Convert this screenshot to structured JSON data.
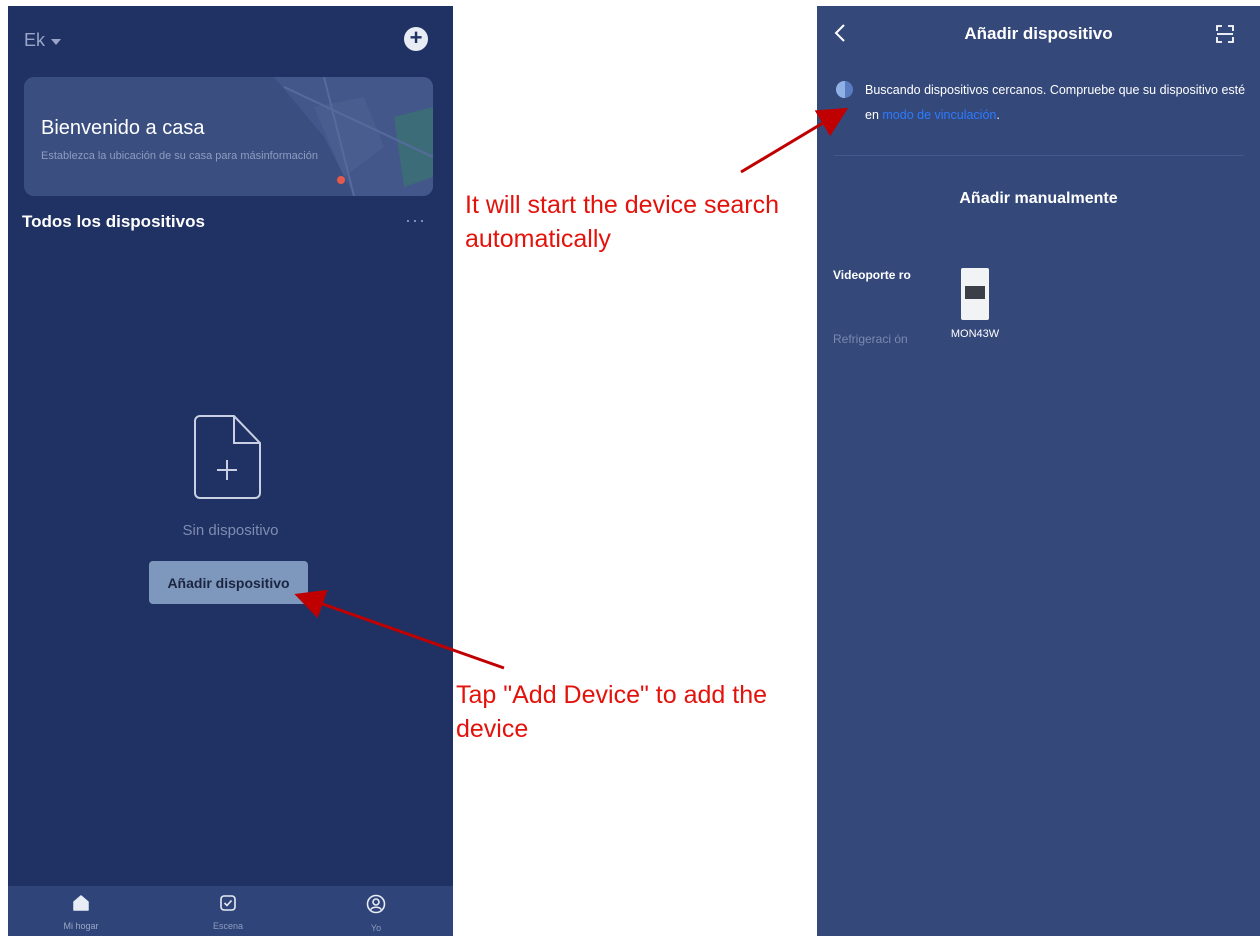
{
  "left_screen": {
    "home_name": "Ek",
    "welcome": {
      "title": "Bienvenido a casa",
      "subtitle": "Establezca la ubicación de su casa para másinformación"
    },
    "section_title": "Todos los dispositivos",
    "more_label": "···",
    "empty_text": "Sin dispositivo",
    "add_device_button": "Añadir dispositivo",
    "tabs": [
      {
        "label": "Mi hogar",
        "icon": "home-icon",
        "active": true
      },
      {
        "label": "Escena",
        "icon": "scene-checkbox-icon",
        "active": false
      },
      {
        "label": "Yo",
        "icon": "profile-icon",
        "active": false
      }
    ]
  },
  "right_screen": {
    "title": "Añadir dispositivo",
    "search_text": "Buscando dispositivos cercanos. Compruebe que su dispositivo esté en ",
    "search_link": "modo de vinculación",
    "search_end": ".",
    "manual_title": "Añadir manualmente",
    "categories": [
      {
        "label": "Videoporte ro",
        "selected": true
      },
      {
        "label": "Refrigeraci ón",
        "selected": false
      }
    ],
    "devices": [
      {
        "name": "MON43W"
      }
    ]
  },
  "annotations": {
    "top": "It will start the device search automatically",
    "bottom": "Tap \"Add Device\" to add the device"
  },
  "colors": {
    "left_bg": "#203263",
    "right_bg": "#34487a",
    "button": "#7e97bd",
    "link": "#2d7bff",
    "annotation": "#e3120b"
  }
}
